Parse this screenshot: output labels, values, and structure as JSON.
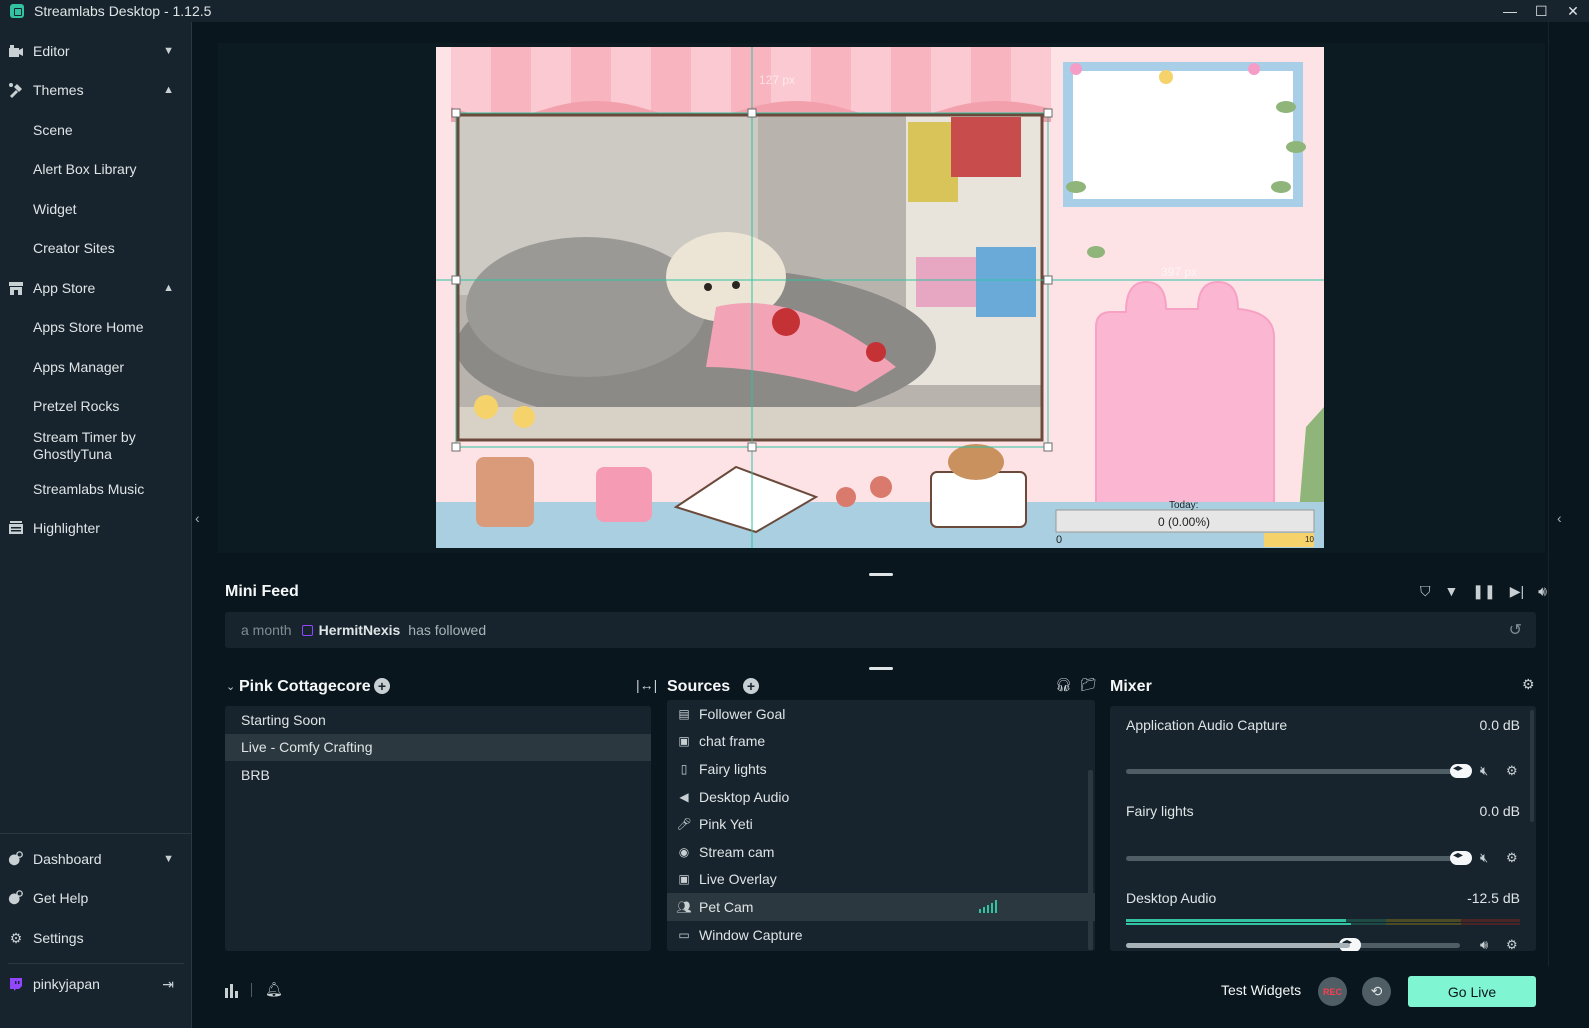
{
  "window": {
    "title": "Streamlabs Desktop - 1.12.5"
  },
  "sidebar": {
    "items": [
      {
        "label": "Editor",
        "icon": "editor-icon",
        "chevron": "⌄"
      },
      {
        "label": "Themes",
        "icon": "themes-icon",
        "chevron": "⌃"
      },
      {
        "label": "Scene"
      },
      {
        "label": "Alert Box Library"
      },
      {
        "label": "Widget"
      },
      {
        "label": "Creator Sites"
      },
      {
        "label": "App Store",
        "icon": "app-store-icon",
        "chevron": "⌃"
      },
      {
        "label": "Apps Store Home"
      },
      {
        "label": "Apps Manager"
      },
      {
        "label": "Pretzel Rocks"
      },
      {
        "label": "Stream Timer by GhostlyTuna"
      },
      {
        "label": "Streamlabs Music"
      },
      {
        "label": "Highlighter",
        "icon": "highlighter-icon"
      }
    ],
    "bottom": [
      {
        "label": "Dashboard",
        "icon": "dashboard-icon",
        "chevron": "⌄"
      },
      {
        "label": "Get Help",
        "icon": "help-icon"
      },
      {
        "label": "Settings",
        "icon": "gear-icon"
      }
    ],
    "user": {
      "name": "pinkyjapan"
    }
  },
  "preview": {
    "guide_top": "127 px",
    "guide_right": "397 px",
    "goal_today": "Today:",
    "goal_value": "0 (0.00%)",
    "goal_min": "0",
    "goal_max": "10"
  },
  "minifeed": {
    "title": "Mini Feed",
    "event": {
      "time": "a month",
      "user": "HermitNexis",
      "text": "has followed"
    }
  },
  "scenes": {
    "title": "Pink Cottagecore",
    "items": [
      "Starting Soon",
      "Live - Comfy Crafting",
      "BRB"
    ],
    "active_index": 1
  },
  "sources": {
    "title": "Sources",
    "items": [
      {
        "label": "Follower Goal",
        "icon": "widget-icon"
      },
      {
        "label": "chat frame",
        "icon": "image-icon"
      },
      {
        "label": "Fairy lights",
        "icon": "file-icon"
      },
      {
        "label": "Desktop Audio",
        "icon": "speaker-icon"
      },
      {
        "label": "Pink Yeti",
        "icon": "microphone-icon"
      },
      {
        "label": "Stream cam",
        "icon": "webcam-icon"
      },
      {
        "label": "Live Overlay",
        "icon": "image-icon"
      },
      {
        "label": "Pet Cam",
        "icon": "users-icon"
      },
      {
        "label": "Window Capture",
        "icon": "window-icon"
      }
    ],
    "active_index": 7
  },
  "mixer": {
    "title": "Mixer",
    "channels": [
      {
        "name": "Application Audio Capture",
        "db": "0.0 dB",
        "volume": 1.0,
        "muted_icon": true
      },
      {
        "name": "Fairy lights",
        "db": "0.0 dB",
        "volume": 1.0,
        "muted_icon": true
      },
      {
        "name": "Desktop Audio",
        "db": "-12.5 dB",
        "volume": 0.68,
        "level": 0.66,
        "muted_icon": false
      }
    ]
  },
  "footer": {
    "test_widgets": "Test Widgets",
    "rec": "REC",
    "go_live": "Go Live"
  },
  "colors": {
    "accent": "#31c3a2",
    "go_live": "#80f5d2",
    "rec": "#fc3e4f",
    "twitch": "#9146ff",
    "sidebar_bg": "#17242d",
    "app_bg": "#09161d"
  }
}
